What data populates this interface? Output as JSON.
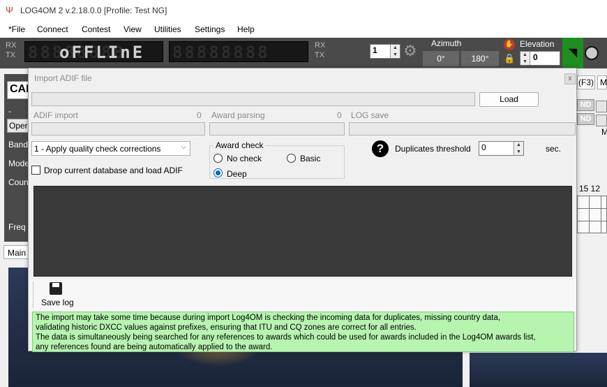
{
  "window": {
    "title": "LOG4OM 2 v.2.18.0.0 [Profile: Test NG]"
  },
  "menu": [
    "*File",
    "Connect",
    "Contest",
    "View",
    "Utilities",
    "Settings",
    "Help"
  ],
  "toolbar": {
    "rx_tx": [
      "RX",
      "TX"
    ],
    "lcd_display_ghost": "88888888",
    "lcd_display": "oFFLInE",
    "freq_display": "88888888",
    "rx_tx_2": [
      "RX",
      "TX"
    ],
    "radio_index": "1",
    "azimuth_label": "Azimuth",
    "azimuth_value": "0°",
    "azimuth_value_2": "180°",
    "elevation_label": "Elevation",
    "elevation_value": "0"
  },
  "background": {
    "cal_label": "CAL",
    "dash": "-",
    "oper": "Oper",
    "labels": [
      "Band",
      "Mode",
      "Coun",
      "Freq"
    ],
    "main_tab": "Main",
    "f3": "(F3)",
    "m_btn": "M",
    "nd1": "ND",
    "nd2": "ND",
    "m_label": "M",
    "nums": "15 12"
  },
  "dialog": {
    "title": "Import ADIF file",
    "close": "x",
    "load_button": "Load",
    "adif_import_label": "ADIF import",
    "adif_import_count": "0",
    "award_parsing_label": "Award parsing",
    "award_parsing_count": "0",
    "log_save_label": "LOG save",
    "quality_check_selected": "1 - Apply quality check corrections",
    "drop_db_label": "Drop current database and load ADIF",
    "award_check": {
      "title": "Award check",
      "options": [
        "No check",
        "Basic",
        "Deep"
      ],
      "selected": "Deep"
    },
    "duplicates_label": "Duplicates threshold",
    "duplicates_value": "0",
    "duplicates_unit": "sec.",
    "save_log": "Save log",
    "info_lines": [
      "The import may take some time because during  import Log4OM is checking the incoming data for duplicates, missing country data,",
      "validating historic DXCC values against prefixes, ensuring that ITU and CQ zones are correct for all entries.",
      "The data is simultaneously being searched for any references to awards which could be used for awards included in the Log4OM awards list,",
      "any references found are being automatically applied to the award."
    ]
  }
}
